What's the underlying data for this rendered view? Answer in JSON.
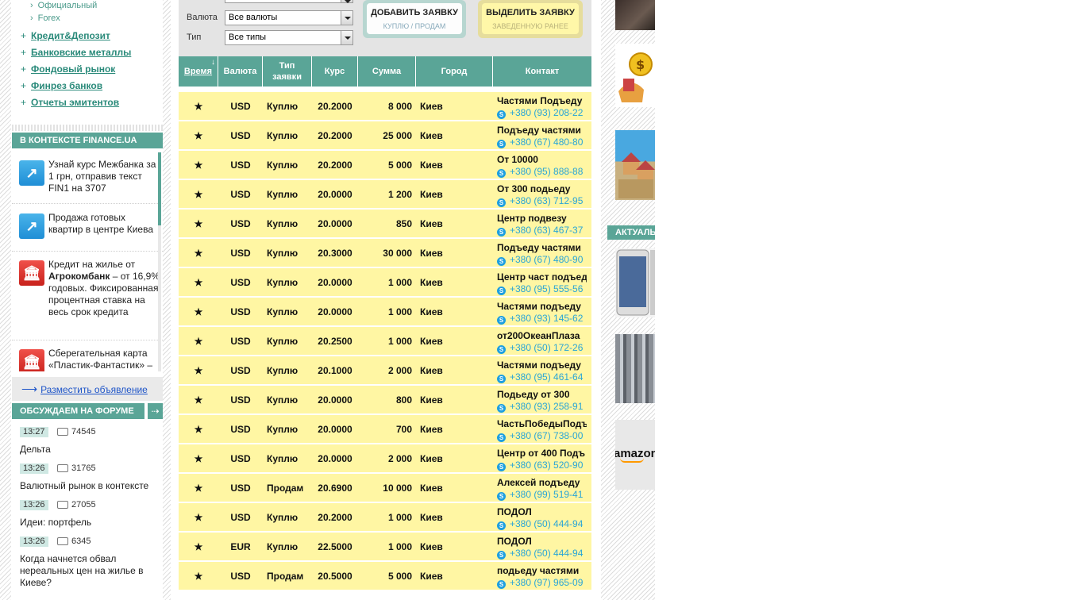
{
  "left": {
    "submenu": [
      "Официальный",
      "Forex"
    ],
    "menu": [
      "Кредит&Депозит",
      "Банковские металлы",
      "Фондовый рынок",
      "Финрез банков",
      "Отчеты эмитентов"
    ],
    "context_title": "В КОНТЕКСТЕ FINANCE.UA",
    "context_items": [
      {
        "text": "Узнай курс Межбанка за 1 грн, отправив текст FIN1 на 3707",
        "icon": "external-link-icon"
      },
      {
        "text": "Продажа готовых квартир в центре Киева",
        "icon": "external-link-icon"
      },
      {
        "pre": "Кредит на жилье от ",
        "bold": "Агрокомбанк",
        "post": " – от 16,9% годовых. Фиксированная процентная ставка на весь срок кредита",
        "icon": "bank-icon"
      },
      {
        "text": "Сберегательная карта «Пластик-Фантастик» –",
        "icon": "bank-icon"
      }
    ],
    "post_ad": "Разместить объявление",
    "forum_title": "ОБСУЖДАЕМ НА ФОРУМЕ",
    "forum": [
      {
        "time": "13:27",
        "count": "74545",
        "title": "Дельта"
      },
      {
        "time": "13:26",
        "count": "31765",
        "title": "Валютный рынок в контексте"
      },
      {
        "time": "13:26",
        "count": "27055",
        "title": "Идеи: портфель"
      },
      {
        "time": "13:26",
        "count": "6345",
        "title": "Когда начнется обвал нереальных цен на жилье в Киеве?"
      }
    ]
  },
  "filters": {
    "currency_label": "Валюта",
    "currency_value": "Все валюты",
    "type_label": "Тип",
    "type_value": "Все типы"
  },
  "buttons": {
    "add_title": "ДОБАВИТЬ ЗАЯВКУ",
    "add_sub": "КУПЛЮ / ПРОДАМ",
    "hl_title": "ВЫДЕЛИТЬ ЗАЯВКУ",
    "hl_sub": "ЗАВЕДЕННУЮ РАНЕЕ"
  },
  "table": {
    "headers": {
      "time": "Время",
      "currency": "Валюта",
      "type": "Тип заявки",
      "rate": "Курс",
      "sum": "Сумма",
      "city": "Город",
      "contact": "Контакт"
    },
    "rows": [
      {
        "star": "★",
        "cur": "USD",
        "type": "Куплю",
        "rate": "20.2000",
        "sum": "8 000",
        "city": "Киев",
        "name": "Частями Подъеду",
        "phone": "+380 (93) 208-22"
      },
      {
        "star": "★",
        "cur": "USD",
        "type": "Куплю",
        "rate": "20.2000",
        "sum": "25 000",
        "city": "Киев",
        "name": "Подъеду частями",
        "phone": "+380 (67) 480-80"
      },
      {
        "star": "★",
        "cur": "USD",
        "type": "Куплю",
        "rate": "20.2000",
        "sum": "5 000",
        "city": "Киев",
        "name": "От 10000",
        "phone": "+380 (95) 888-88"
      },
      {
        "star": "★",
        "cur": "USD",
        "type": "Куплю",
        "rate": "20.0000",
        "sum": "1 200",
        "city": "Киев",
        "name": "От 300 подьеду",
        "phone": "+380 (63) 712-95"
      },
      {
        "star": "★",
        "cur": "USD",
        "type": "Куплю",
        "rate": "20.0000",
        "sum": "850",
        "city": "Киев",
        "name": "Центр подвезу",
        "phone": "+380 (63) 467-37"
      },
      {
        "star": "★",
        "cur": "USD",
        "type": "Куплю",
        "rate": "20.3000",
        "sum": "30 000",
        "city": "Киев",
        "name": "Подъеду частями",
        "phone": "+380 (67) 480-90"
      },
      {
        "star": "★",
        "cur": "USD",
        "type": "Куплю",
        "rate": "20.0000",
        "sum": "1 000",
        "city": "Киев",
        "name": "Центр част подъед",
        "phone": "+380 (95) 555-56"
      },
      {
        "star": "★",
        "cur": "USD",
        "type": "Куплю",
        "rate": "20.0000",
        "sum": "1 000",
        "city": "Киев",
        "name": "Частями подъеду",
        "phone": "+380 (93) 145-62"
      },
      {
        "star": "★",
        "cur": "USD",
        "type": "Куплю",
        "rate": "20.2500",
        "sum": "1 000",
        "city": "Киев",
        "name": "от200ОкеанПлаза",
        "phone": "+380 (50) 172-26"
      },
      {
        "star": "★",
        "cur": "USD",
        "type": "Куплю",
        "rate": "20.1000",
        "sum": "2 000",
        "city": "Киев",
        "name": "Частями подъеду",
        "phone": "+380 (95) 461-64"
      },
      {
        "star": "★",
        "cur": "USD",
        "type": "Куплю",
        "rate": "20.0000",
        "sum": "800",
        "city": "Киев",
        "name": "Подьеду от 300",
        "phone": "+380 (93) 258-91"
      },
      {
        "star": "★",
        "cur": "USD",
        "type": "Куплю",
        "rate": "20.0000",
        "sum": "700",
        "city": "Киев",
        "name": "ЧастьПобедыПодъ",
        "phone": "+380 (67) 738-00"
      },
      {
        "star": "★",
        "cur": "USD",
        "type": "Куплю",
        "rate": "20.0000",
        "sum": "2 000",
        "city": "Киев",
        "name": "Центр от 400 Подъ",
        "phone": "+380 (63) 520-90"
      },
      {
        "star": "★",
        "cur": "USD",
        "type": "Продам",
        "rate": "20.6900",
        "sum": "10 000",
        "city": "Киев",
        "name": "Алексей подъеду",
        "phone": "+380 (99) 519-41"
      },
      {
        "star": "★",
        "cur": "USD",
        "type": "Куплю",
        "rate": "20.2000",
        "sum": "1 000",
        "city": "Киев",
        "name": "ПОДОЛ",
        "phone": "+380 (50) 444-94"
      },
      {
        "star": "★",
        "cur": "EUR",
        "type": "Куплю",
        "rate": "22.5000",
        "sum": "1 000",
        "city": "Киев",
        "name": "ПОДОЛ",
        "phone": "+380 (50) 444-94"
      },
      {
        "star": "★",
        "cur": "USD",
        "type": "Продам",
        "rate": "20.5000",
        "sum": "5 000",
        "city": "Киев",
        "name": "подьеду частями",
        "phone": "+380 (97) 965-09"
      }
    ]
  },
  "right": {
    "aktual_title": "АКТУАЛЬ",
    "amazon_text": "amazon"
  },
  "colors": {
    "accent": "#5aa597",
    "row_bg": "#fff6a3",
    "phone": "#2aa5d6",
    "link": "#1d54c8"
  }
}
